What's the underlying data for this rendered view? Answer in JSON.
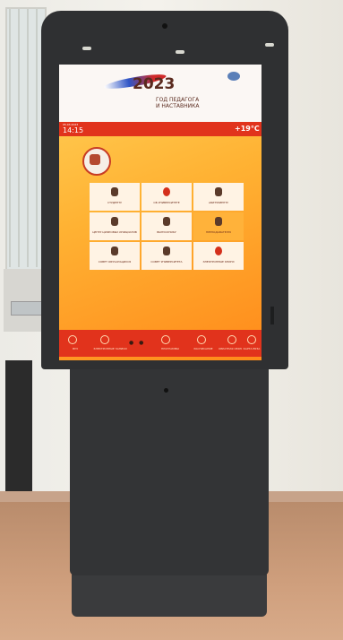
{
  "screen": {
    "banner": {
      "year": "2023",
      "caption_line1": "ГОД ПЕДАГОГА",
      "caption_line2": "И НАСТАВНИКА"
    },
    "status_bar": {
      "date": "05.03.2023",
      "time": "14:15",
      "temperature": "+19°C"
    },
    "tiles": [
      {
        "label": "СТУДЕНТУ",
        "icon": "person-icon"
      },
      {
        "label": "ОБ УНИВЕРСИТЕТЕ",
        "icon": "info-icon"
      },
      {
        "label": "АБИТУРИЕНТУ",
        "icon": "person-icon"
      },
      {
        "label": "ЦЕНТР ЦИФРОВЫХ ИНИЦИАТИВ",
        "icon": "building-icon"
      },
      {
        "label": "ВЫПУСКНИКУ",
        "icon": "person-icon"
      },
      {
        "label": "ПРЕПОДАВАТЕЛЮ",
        "icon": "person-icon",
        "active": true
      },
      {
        "label": "СОВЕТ ОБУЧАЮЩИХСЯ",
        "icon": "person-icon"
      },
      {
        "label": "СОВЕТ УНИВЕРСИТЕТА",
        "icon": "person-icon"
      },
      {
        "label": "ЭЛЕКТРОННЫЕ КНИГИ",
        "icon": "info-icon"
      }
    ],
    "bottom_nav": [
      {
        "label": "ВУЗ"
      },
      {
        "label": "ЭЛЕКТРОННЫЕ ЗАПИСИ"
      },
      {
        "label": "ПРОГРАММЫ"
      },
      {
        "label": "РАСПИСАНИЕ"
      },
      {
        "label": "ОБРАТНАЯ СВЯЗЬ"
      },
      {
        "label": "КАРТА ВУЗА"
      }
    ],
    "pager": "● ●"
  }
}
